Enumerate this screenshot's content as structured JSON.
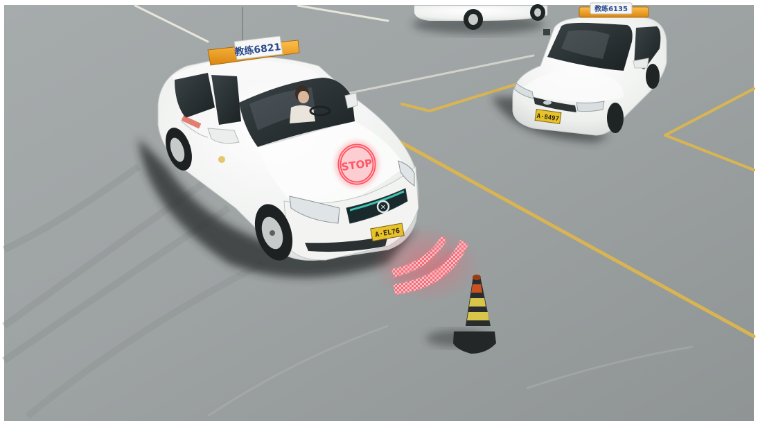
{
  "scene": {
    "main_car": {
      "roof_sign": "教练6821",
      "plate": "A·EL76",
      "hood_warning_text": "STOP"
    },
    "right_car": {
      "roof_sign": "教练6135",
      "plate": "A·8497"
    }
  },
  "colors": {
    "asphalt": "#9ea3a4",
    "lane_marking": "#d8b552",
    "car_body": "#f1f2f0",
    "roof_light": "#f0a11c",
    "plate": "#e8c22a",
    "warning_red": "#ff4a5a",
    "cone_orange": "#c9521f",
    "cone_yellow": "#d8c64a"
  }
}
